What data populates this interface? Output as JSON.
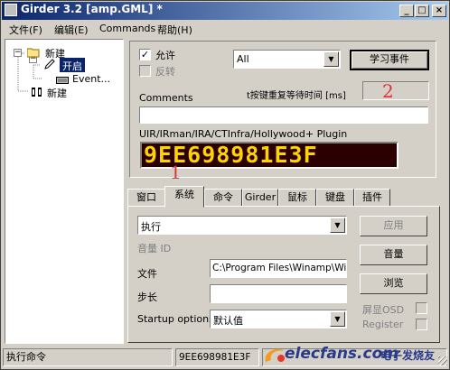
{
  "window": {
    "title": "Girder 3.2 [amp.GML] *"
  },
  "title_buttons": {
    "minimize": "_",
    "maximize": "□",
    "close": "×"
  },
  "menu": [
    "文件(F)",
    "编辑(E)",
    "Commands",
    "帮助(H)"
  ],
  "tree": [
    {
      "label": "新建",
      "icon": "folder-icon"
    },
    {
      "label": "开启",
      "icon": "pencil-icon",
      "selected": true
    },
    {
      "label": "Event...",
      "icon": "keyboard-icon"
    },
    {
      "label": "新建",
      "icon": "multigroup-icon"
    }
  ],
  "event": {
    "enable_label": "允许",
    "enable_checked": true,
    "invert_label": "反转",
    "invert_checked": false,
    "event_select_value": "All",
    "learn_button": "学习事件",
    "repeat_label": "t按键重复等待时间 [ms]",
    "repeat_value": "",
    "comments_label": "Comments",
    "comments_value": "",
    "plugin_label": "UIR/IRman/IRA/CTInfra/Hollywood+ Plugin",
    "led_code": "9EE698981E3F"
  },
  "tabs": [
    "窗口",
    "系统",
    "命令",
    "Girder",
    "鼠标",
    "键盘",
    "插件"
  ],
  "active_tab": "系统",
  "system": {
    "action_value": "执行",
    "volume_id_label": "音量 ID",
    "file_label": "文件",
    "file_value": "C:\\Program Files\\Winamp\\Win",
    "step_label": "步长",
    "step_value": "",
    "startup_label": "Startup options",
    "startup_value": "默认值",
    "apply_button": "应用",
    "volume_button": "音量",
    "browse_button": "浏览",
    "osd_label": "屏显OSD",
    "register_label": "Register"
  },
  "statusbar": {
    "left": "执行命令",
    "code": "9EE698981E3F"
  },
  "annotations": {
    "one": "1",
    "two": "2"
  },
  "watermark": {
    "brand": "elecfans.com",
    "cn": "电子发烧友"
  },
  "colors": {
    "title_start": "#0a246a",
    "title_end": "#a6caf0",
    "selection": "#0a246a",
    "led_text": "#ffd200",
    "led_bg": "#2a0000",
    "annotation": "#e0303a"
  }
}
